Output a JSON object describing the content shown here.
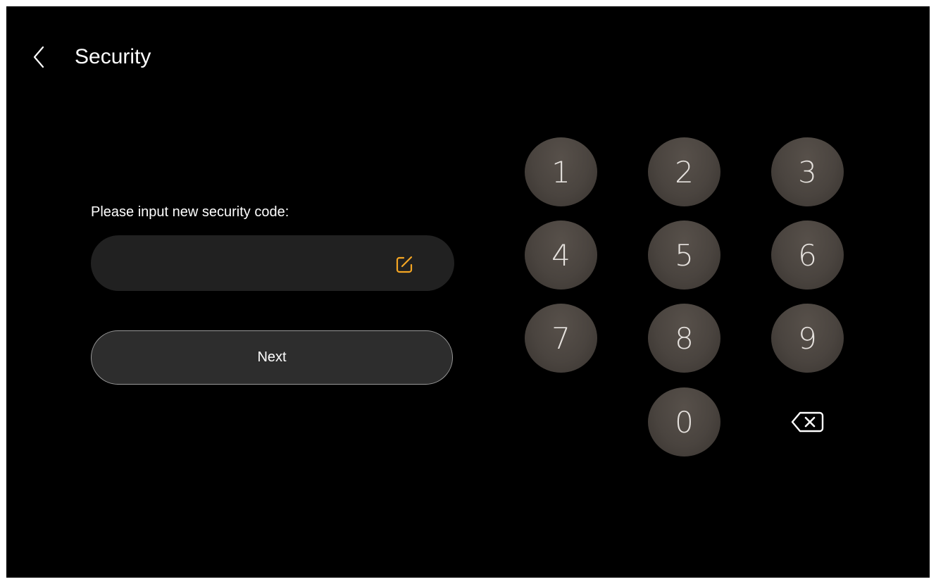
{
  "header": {
    "title": "Security",
    "back_icon": "chevron-left-icon"
  },
  "form": {
    "prompt": "Please input new security code:",
    "code_value": "",
    "code_placeholder": "",
    "edit_icon": "edit-icon",
    "next_label": "Next"
  },
  "keypad": {
    "keys": [
      "1",
      "2",
      "3",
      "4",
      "5",
      "6",
      "7",
      "8",
      "9",
      "0"
    ],
    "backspace_icon": "backspace-icon"
  },
  "colors": {
    "background": "#000000",
    "field_background": "#212121",
    "button_background": "#2d2d2d",
    "key_background": "#4a443f",
    "accent": "#f5a623",
    "text": "#ffffff"
  }
}
